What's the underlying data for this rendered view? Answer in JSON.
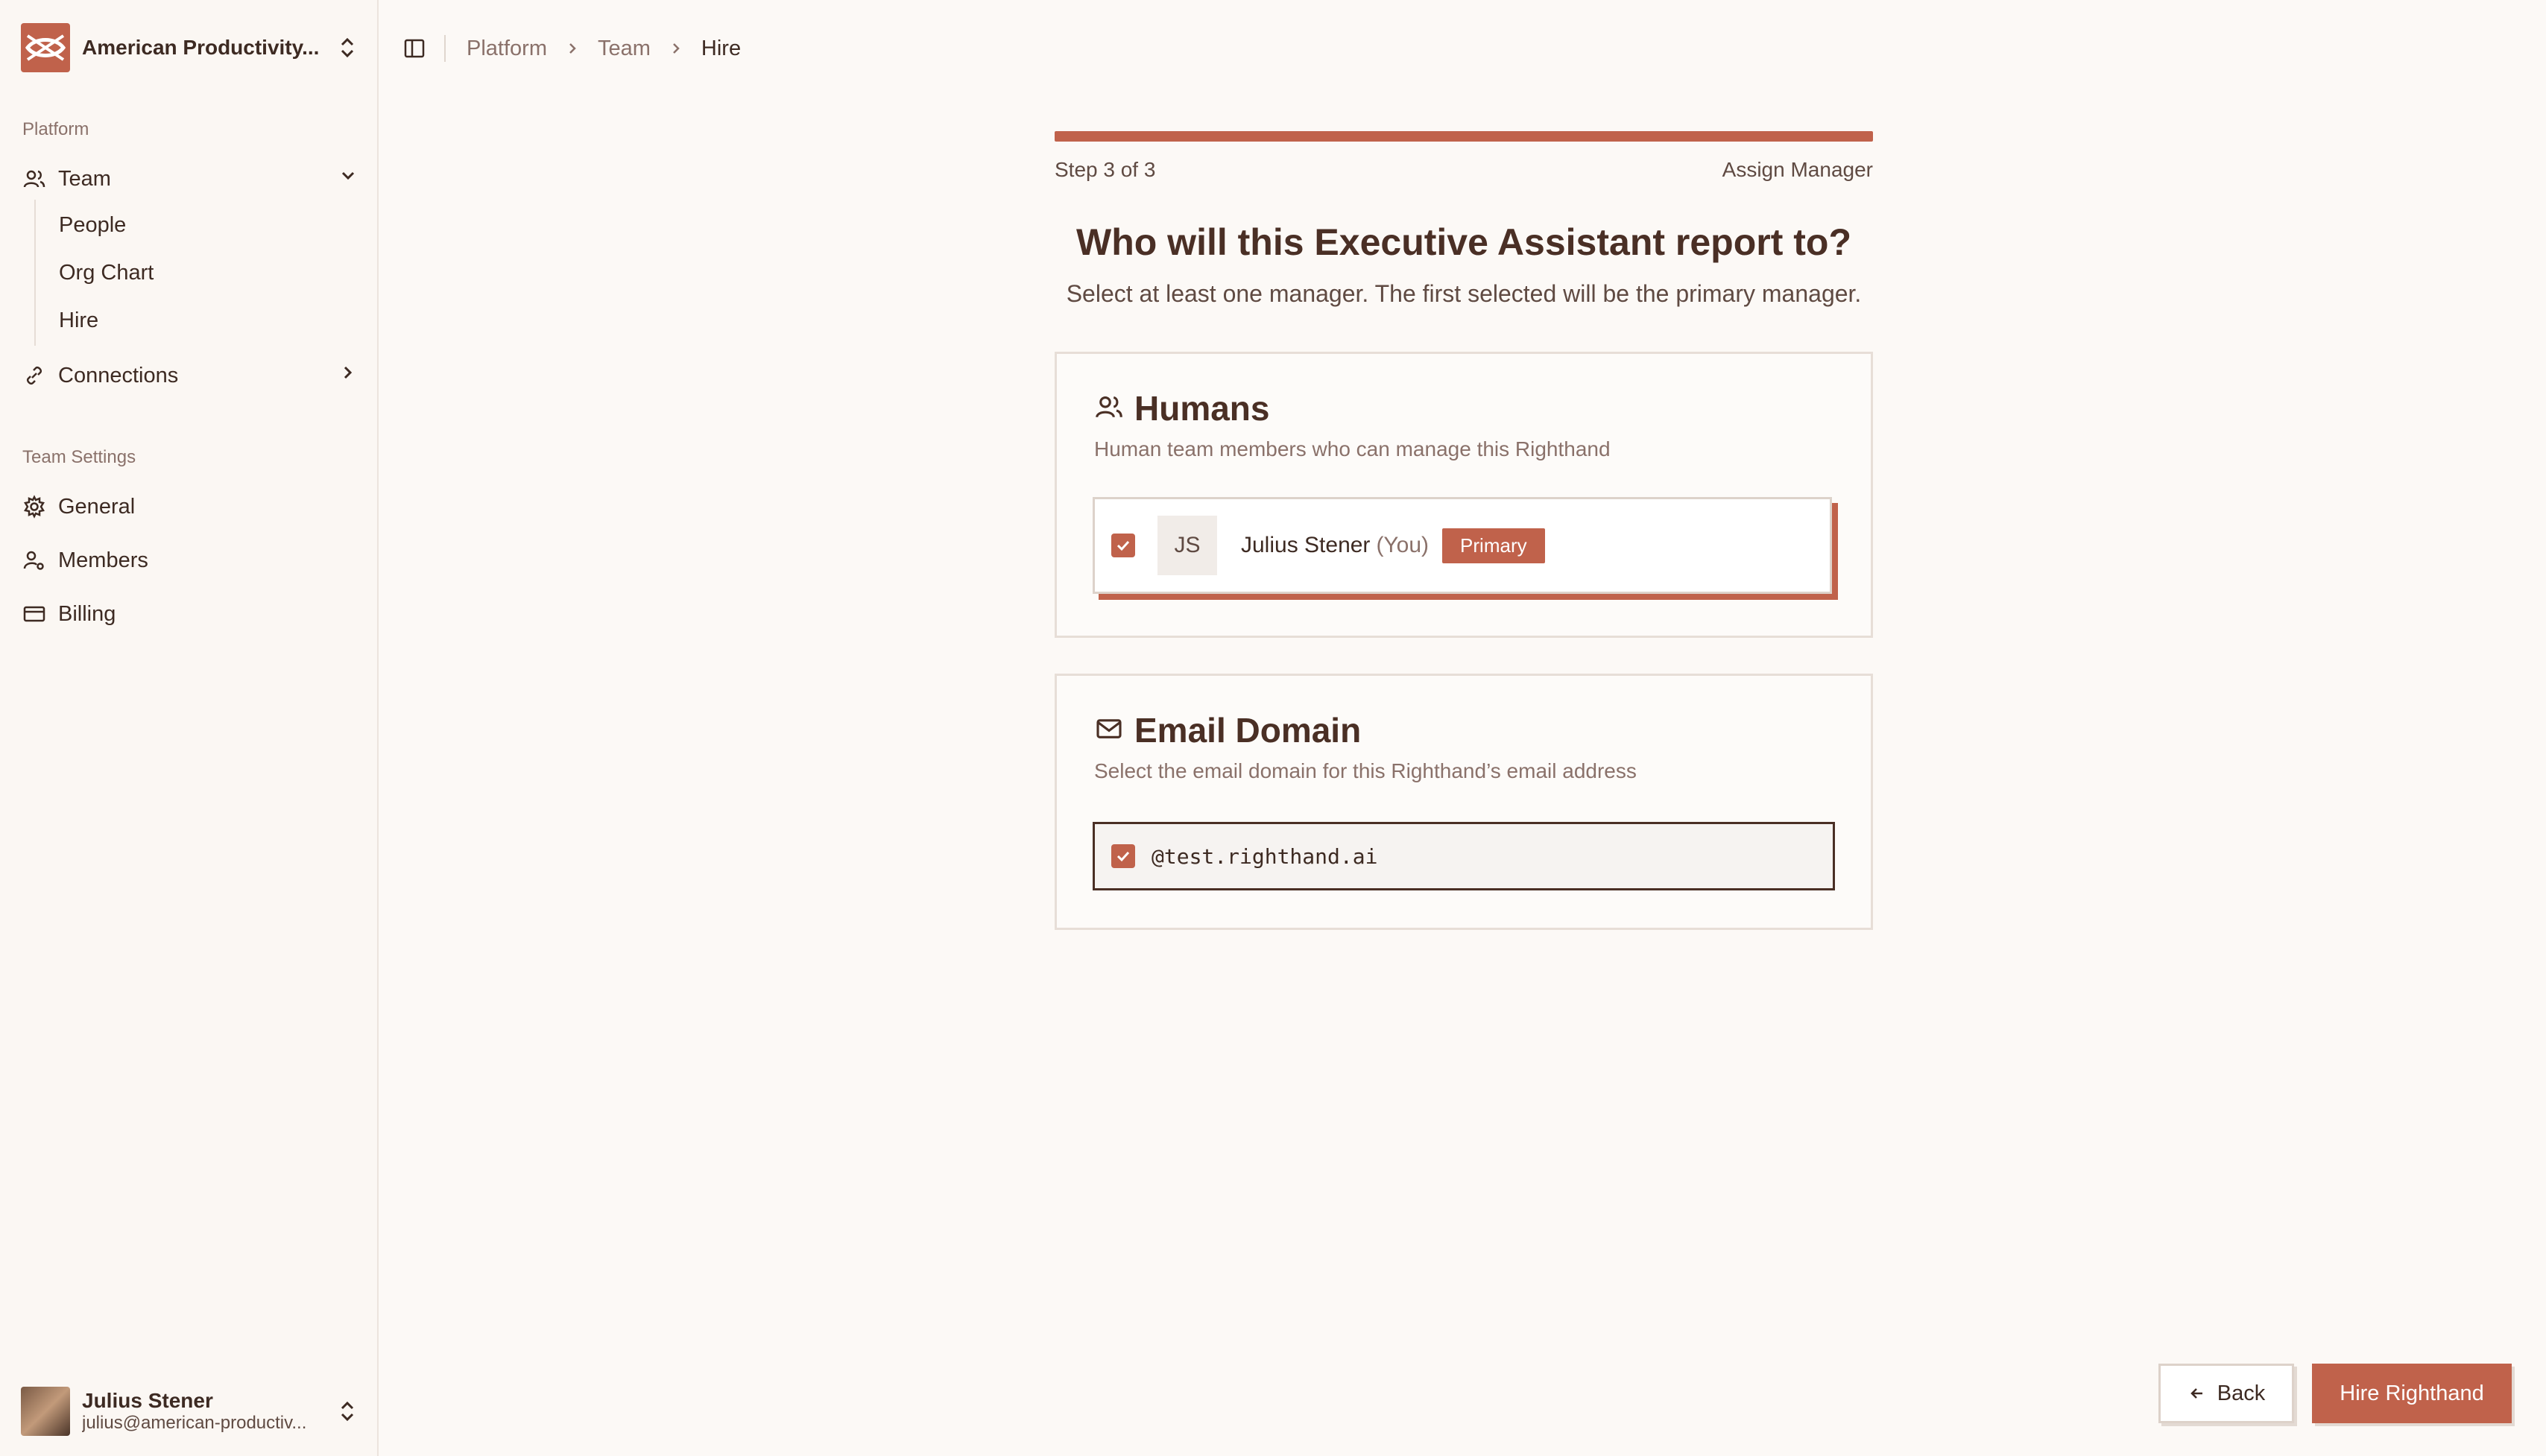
{
  "sidebar": {
    "org_name": "American Productivity...",
    "platform_label": "Platform",
    "team_label": "Team",
    "team_subitems": [
      "People",
      "Org Chart",
      "Hire"
    ],
    "connections_label": "Connections",
    "team_settings_label": "Team Settings",
    "general_label": "General",
    "members_label": "Members",
    "billing_label": "Billing",
    "user_name": "Julius Stener",
    "user_email": "julius@american-productiv..."
  },
  "breadcrumb": [
    "Platform",
    "Team",
    "Hire"
  ],
  "wizard": {
    "step_text": "Step 3 of 3",
    "step_name": "Assign Manager",
    "progress": 1.0,
    "title": "Who will this Executive Assistant report to?",
    "subtitle": "Select at least one manager. The first selected will be the primary manager."
  },
  "humans": {
    "title": "Humans",
    "description": "Human team members who can manage this Righthand",
    "manager_initials": "JS",
    "manager_name": "Julius Stener",
    "manager_you": "(You)",
    "badge": "Primary"
  },
  "email_domain": {
    "title": "Email Domain",
    "description": "Select the email domain for this Righthand’s email address",
    "domain": "@test.righthand.ai"
  },
  "actions": {
    "back_label": "Back",
    "hire_label": "Hire Righthand"
  },
  "colors": {
    "accent": "#c0624b",
    "background": "#fcf9f6",
    "text": "#3d2a22"
  }
}
